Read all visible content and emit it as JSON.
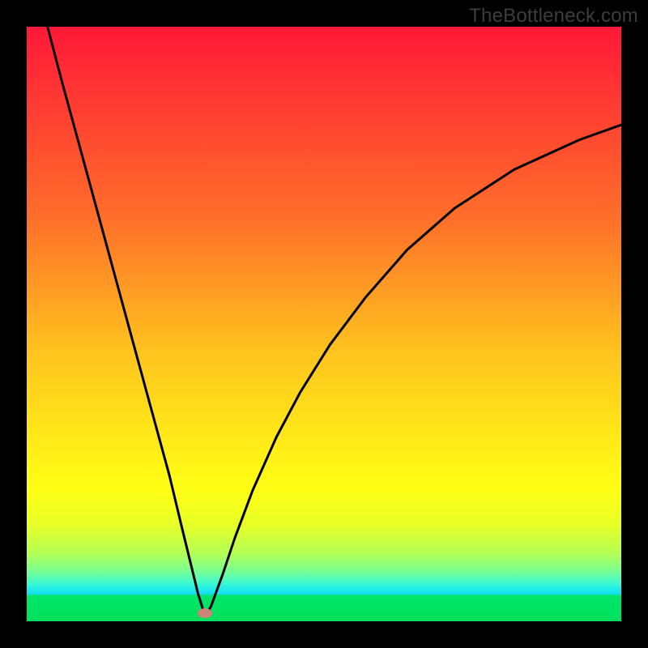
{
  "watermark": "TheBottleneck.com",
  "colors": {
    "frame": "#000000",
    "gradient_top": "#ff1838",
    "gradient_mid": "#ffe619",
    "gradient_bottom": "#00e05a",
    "curve": "#000000",
    "marker": "#cf8379"
  },
  "chart_data": {
    "type": "line",
    "title": "",
    "xlabel": "",
    "ylabel": "",
    "xlim": [
      0,
      100
    ],
    "ylim": [
      0,
      100
    ],
    "series": [
      {
        "name": "bottleneck-curve",
        "x": [
          3.5,
          6,
          9,
          12,
          15,
          18,
          21,
          24,
          26,
          27.5,
          28.8,
          29.8,
          30.2,
          31,
          33,
          35,
          38,
          42,
          46,
          51,
          57,
          64,
          72,
          82,
          93,
          100
        ],
        "values": [
          100,
          90.5,
          79.5,
          68.5,
          57.5,
          46.5,
          35.5,
          24.5,
          16.2,
          10,
          4.7,
          1.5,
          1.2,
          2.5,
          8,
          14,
          22,
          31,
          38.5,
          46.5,
          54.5,
          62.5,
          69.5,
          76,
          81,
          83.5
        ]
      }
    ],
    "annotations": [
      {
        "name": "optimal-marker",
        "x": 30,
        "y": 1.4
      }
    ]
  }
}
